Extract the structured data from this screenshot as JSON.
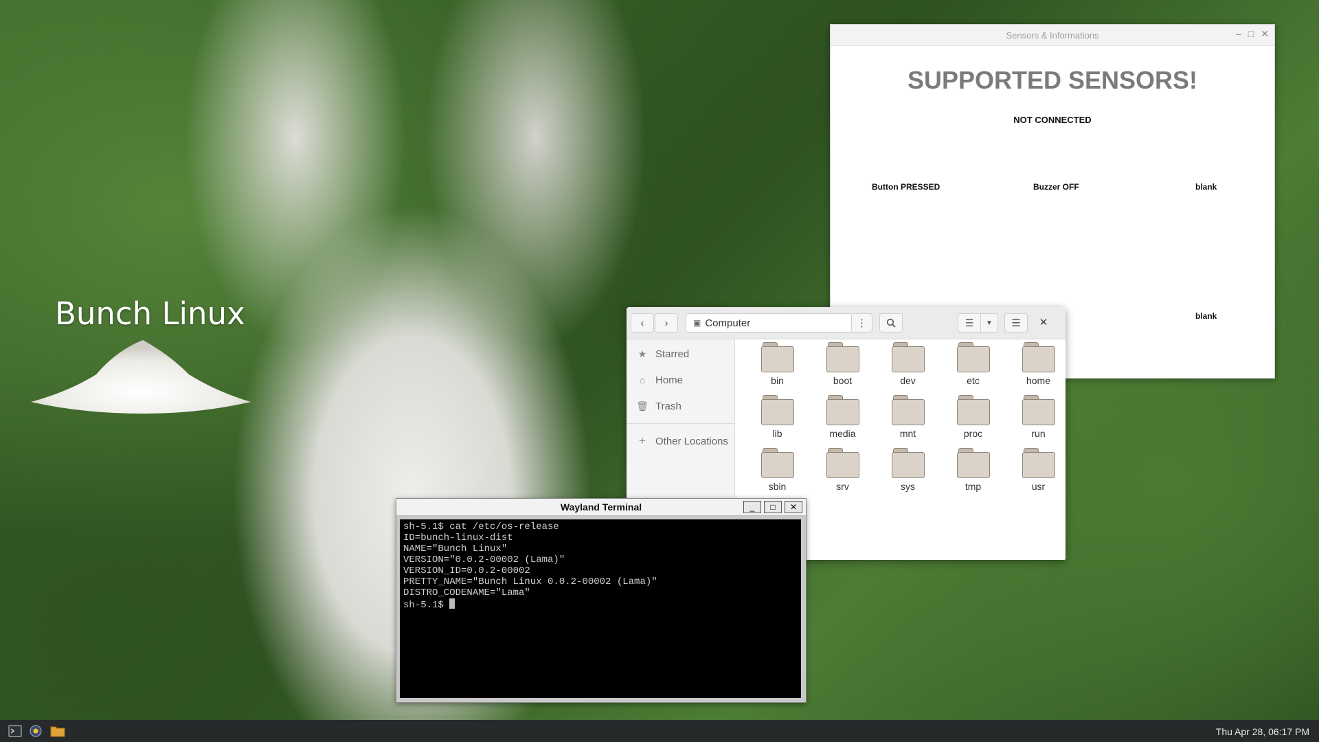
{
  "wallpaper": {
    "title": "Bunch Linux"
  },
  "sensors_window": {
    "title": "Sensors & Informations",
    "headline": "SUPPORTED SENSORS!",
    "status": "NOT CONNECTED",
    "labels": [
      "Button PRESSED",
      "Buzzer OFF",
      "blank",
      "blank"
    ]
  },
  "file_manager": {
    "location": "Computer",
    "sidebar": [
      {
        "label": "Starred",
        "icon": "star-icon"
      },
      {
        "label": "Home",
        "icon": "home-icon"
      },
      {
        "label": "Trash",
        "icon": "trash-icon"
      },
      {
        "label": "Other Locations",
        "icon": "plus-icon"
      }
    ],
    "folders": [
      "bin",
      "boot",
      "dev",
      "etc",
      "home",
      "lib",
      "media",
      "mnt",
      "proc",
      "run",
      "sbin",
      "srv",
      "sys",
      "tmp",
      "usr"
    ]
  },
  "terminal": {
    "title": "Wayland Terminal",
    "lines": [
      "sh-5.1$ cat /etc/os-release",
      "ID=bunch-linux-dist",
      "NAME=\"Bunch Linux\"",
      "VERSION=\"0.0.2-00002 (Lama)\"",
      "VERSION_ID=0.0.2-00002",
      "PRETTY_NAME=\"Bunch Linux 0.0.2-00002 (Lama)\"",
      "DISTRO_CODENAME=\"Lama\""
    ],
    "prompt": "sh-5.1$ "
  },
  "taskbar": {
    "clock": "Thu Apr 28, 06:17 PM",
    "launchers": [
      "terminal-icon",
      "settings-icon",
      "folder-icon"
    ]
  }
}
